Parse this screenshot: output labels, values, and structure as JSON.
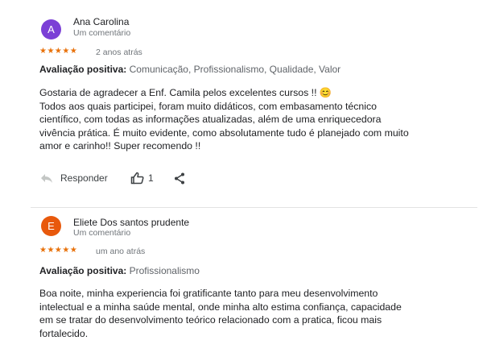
{
  "reviews": [
    {
      "avatar_letter": "A",
      "avatar_color": "#7b3fd6",
      "name": "Ana Carolina",
      "subtitle": "Um comentário",
      "stars": "★★★★★",
      "time": "2 anos atrás",
      "attr_label": "Avaliação positiva:",
      "attr_values": "Comunicação, Profissionalismo, Qualidade, Valor",
      "text_lines": [
        "Gostaria de agradecer a Enf. Camila pelos excelentes cursos !! 😊",
        "Todos aos quais participei, foram muito didáticos, com embasamento técnico",
        "científico, com todas as informações atualizadas, além de uma enriquecedora",
        "vivência prática. É muito evidente, como absolutamente tudo é planejado com muito",
        "amor e carinho!! Super recomendo !!"
      ],
      "reply_label": "Responder",
      "like_count": "1"
    },
    {
      "avatar_letter": "E",
      "avatar_color": "#e8590c",
      "name": "Eliete Dos santos prudente",
      "subtitle": "Um comentário",
      "stars": "★★★★★",
      "time": "um ano atrás",
      "attr_label": "Avaliação positiva:",
      "attr_values": "Profissionalismo",
      "text_lines": [
        "Boa noite, minha experiencia foi gratificante tanto para meu desenvolvimento",
        "intelectual e a minha saúde mental, onde  minha alto estima  confiança, capacidade",
        "em se tratar do desenvolvimento teórico relacionado com a pratica, ficou mais",
        "fortalecido."
      ]
    }
  ]
}
